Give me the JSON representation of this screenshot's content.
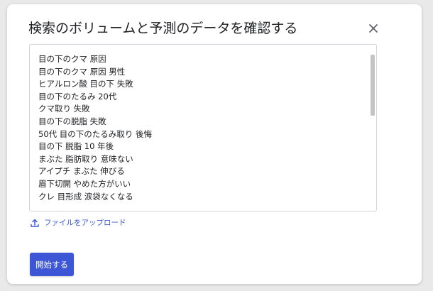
{
  "dialog": {
    "title": "検索のボリュームと予測のデータを確認する",
    "close_icon": "close-icon"
  },
  "keywords": {
    "lines": [
      "目の下のクマ 原因",
      "目の下のクマ 原因 男性",
      "ヒアルロン酸 目の下 失敗",
      "目の下のたるみ 20代",
      "クマ取り 失敗",
      "目の下の脱脂 失敗",
      "50代 目の下のたるみ取り 後悔",
      "目の下 脱脂 10 年後",
      "まぶた 脂肪取り 意味ない",
      "アイプチ まぶた 伸びる",
      "眉下切開 やめた方がいい",
      "クレ 目形成 涙袋なくなる"
    ]
  },
  "upload": {
    "icon": "upload-icon",
    "label": "ファイルをアップロード"
  },
  "actions": {
    "start_label": "開始する"
  },
  "colors": {
    "accent": "#3c56d6",
    "link": "#3b5bd6"
  }
}
